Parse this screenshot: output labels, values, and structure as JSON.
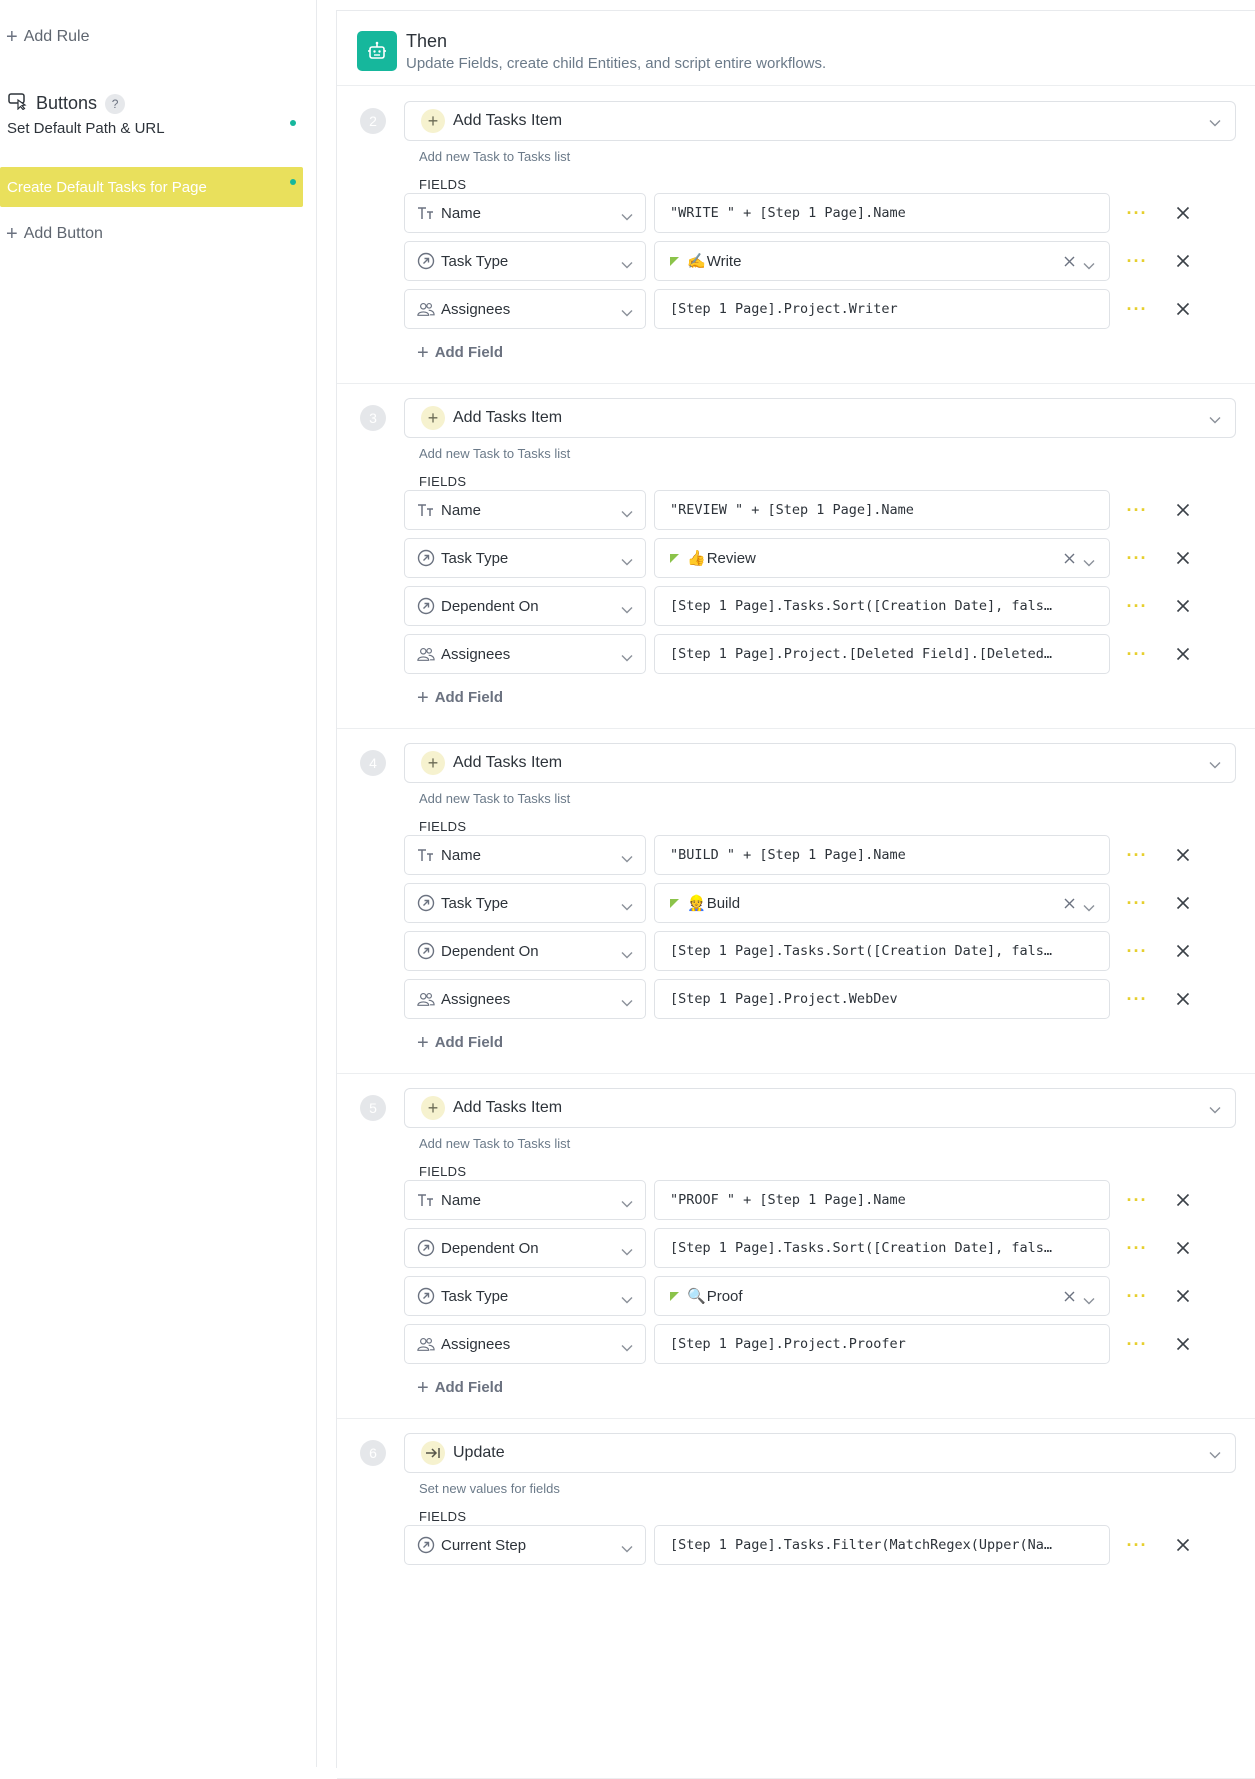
{
  "sidebar": {
    "add_rule": "Add Rule",
    "buttons_header": "Buttons",
    "help": "?",
    "items": [
      {
        "label": "Set Default Path & URL"
      },
      {
        "label": "Create Default Tasks for Page"
      }
    ],
    "add_button": "Add Button"
  },
  "then": {
    "title": "Then",
    "subtitle": "Update Fields, create child Entities, and script entire workflows."
  },
  "fields_label": "FIELDS",
  "add_field_label": "Add Field",
  "steps": [
    {
      "number": "2",
      "action": "Add Tasks Item",
      "description": "Add new Task to Tasks list",
      "fields": [
        {
          "field": "Name",
          "icon": "text-type-icon",
          "value": "\"WRITE \" + [Step 1 Page].Name"
        },
        {
          "field": "Task Type",
          "icon": "relation-arrow-icon",
          "emoji": "✍️",
          "value": "Write"
        },
        {
          "field": "Assignees",
          "icon": "people-icon",
          "value": "[Step 1 Page].Project.Writer"
        }
      ]
    },
    {
      "number": "3",
      "action": "Add Tasks Item",
      "description": "Add new Task to Tasks list",
      "fields": [
        {
          "field": "Name",
          "icon": "text-type-icon",
          "value": "\"REVIEW \" + [Step 1 Page].Name"
        },
        {
          "field": "Task Type",
          "icon": "relation-arrow-icon",
          "emoji": "👍",
          "value": "Review"
        },
        {
          "field": "Dependent On",
          "icon": "relation-arrow-icon",
          "value": "[Step 1 Page].Tasks.Sort([Creation Date], fals…"
        },
        {
          "field": "Assignees",
          "icon": "people-icon",
          "value": "[Step 1 Page].Project.[Deleted Field].[Deleted…"
        }
      ]
    },
    {
      "number": "4",
      "action": "Add Tasks Item",
      "description": "Add new Task to Tasks list",
      "fields": [
        {
          "field": "Name",
          "icon": "text-type-icon",
          "value": "\"BUILD \" + [Step 1 Page].Name"
        },
        {
          "field": "Task Type",
          "icon": "relation-arrow-icon",
          "emoji": "👷",
          "value": "Build"
        },
        {
          "field": "Dependent On",
          "icon": "relation-arrow-icon",
          "value": "[Step 1 Page].Tasks.Sort([Creation Date], fals…"
        },
        {
          "field": "Assignees",
          "icon": "people-icon",
          "value": "[Step 1 Page].Project.WebDev"
        }
      ]
    },
    {
      "number": "5",
      "action": "Add Tasks Item",
      "description": "Add new Task to Tasks list",
      "fields": [
        {
          "field": "Name",
          "icon": "text-type-icon",
          "value": "\"PROOF \" + [Step 1 Page].Name"
        },
        {
          "field": "Dependent On",
          "icon": "relation-arrow-icon",
          "value": "[Step 1 Page].Tasks.Sort([Creation Date], fals…"
        },
        {
          "field": "Task Type",
          "icon": "relation-arrow-icon",
          "emoji": "🔍",
          "value": "Proof"
        },
        {
          "field": "Assignees",
          "icon": "people-icon",
          "value": "[Step 1 Page].Project.Proofer"
        }
      ]
    },
    {
      "number": "6",
      "action": "Update",
      "description": "Set new values for fields",
      "fields": [
        {
          "field": "Current Step",
          "icon": "relation-arrow-icon",
          "value": "[Step 1 Page].Tasks.Filter(MatchRegex(Upper(Na…"
        }
      ]
    }
  ],
  "colors": {
    "accent_teal": "#16b79c",
    "active_yellow": "#e9e05c",
    "dots_yellow": "#e6cf2e",
    "tag_green": "#8bc34a"
  }
}
